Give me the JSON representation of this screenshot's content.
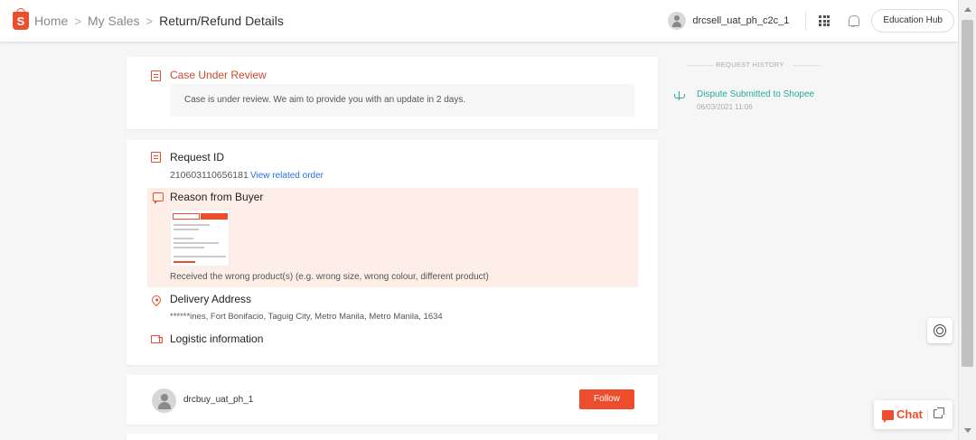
{
  "breadcrumb": {
    "home": "Home",
    "my_sales": "My Sales",
    "current": "Return/Refund Details",
    "separator": ">"
  },
  "header": {
    "username": "drcsell_uat_ph_c2c_1",
    "education_hub": "Education Hub"
  },
  "case_status": {
    "title": "Case Under Review",
    "message": "Case is under review. We aim to provide you with an update in 2 days."
  },
  "request": {
    "id_label": "Request ID",
    "id_value": "210603110656181",
    "view_order_link": "View related order"
  },
  "reason": {
    "title": "Reason from Buyer",
    "text": "Received the wrong product(s) (e.g. wrong size, wrong colour, different product)"
  },
  "delivery": {
    "title": "Delivery Address",
    "address": "******ines, Fort Bonifacio, Taguig City, Metro Manila, Metro Manila, 1634"
  },
  "logistic": {
    "title": "Logistic information"
  },
  "buyer": {
    "name": "drcbuy_uat_ph_1",
    "follow_label": "Follow"
  },
  "history": {
    "heading": "REQUEST HISTORY",
    "items": [
      {
        "title": "Dispute Submitted to Shopee",
        "time": "06/03/2021 11:06"
      }
    ]
  },
  "chat_widget": {
    "label": "Chat"
  },
  "colors": {
    "brand": "#ee4d2d",
    "link": "#2673dd",
    "history_accent": "#26aa99",
    "reason_background": "#fdeee8"
  },
  "icons": [
    "shopee-logo-icon",
    "apps-grid-icon",
    "bell-icon",
    "document-icon",
    "chat-bubble-icon",
    "location-pin-icon",
    "truck-icon",
    "dispute-scale-icon",
    "support-headset-icon",
    "expand-icon"
  ]
}
